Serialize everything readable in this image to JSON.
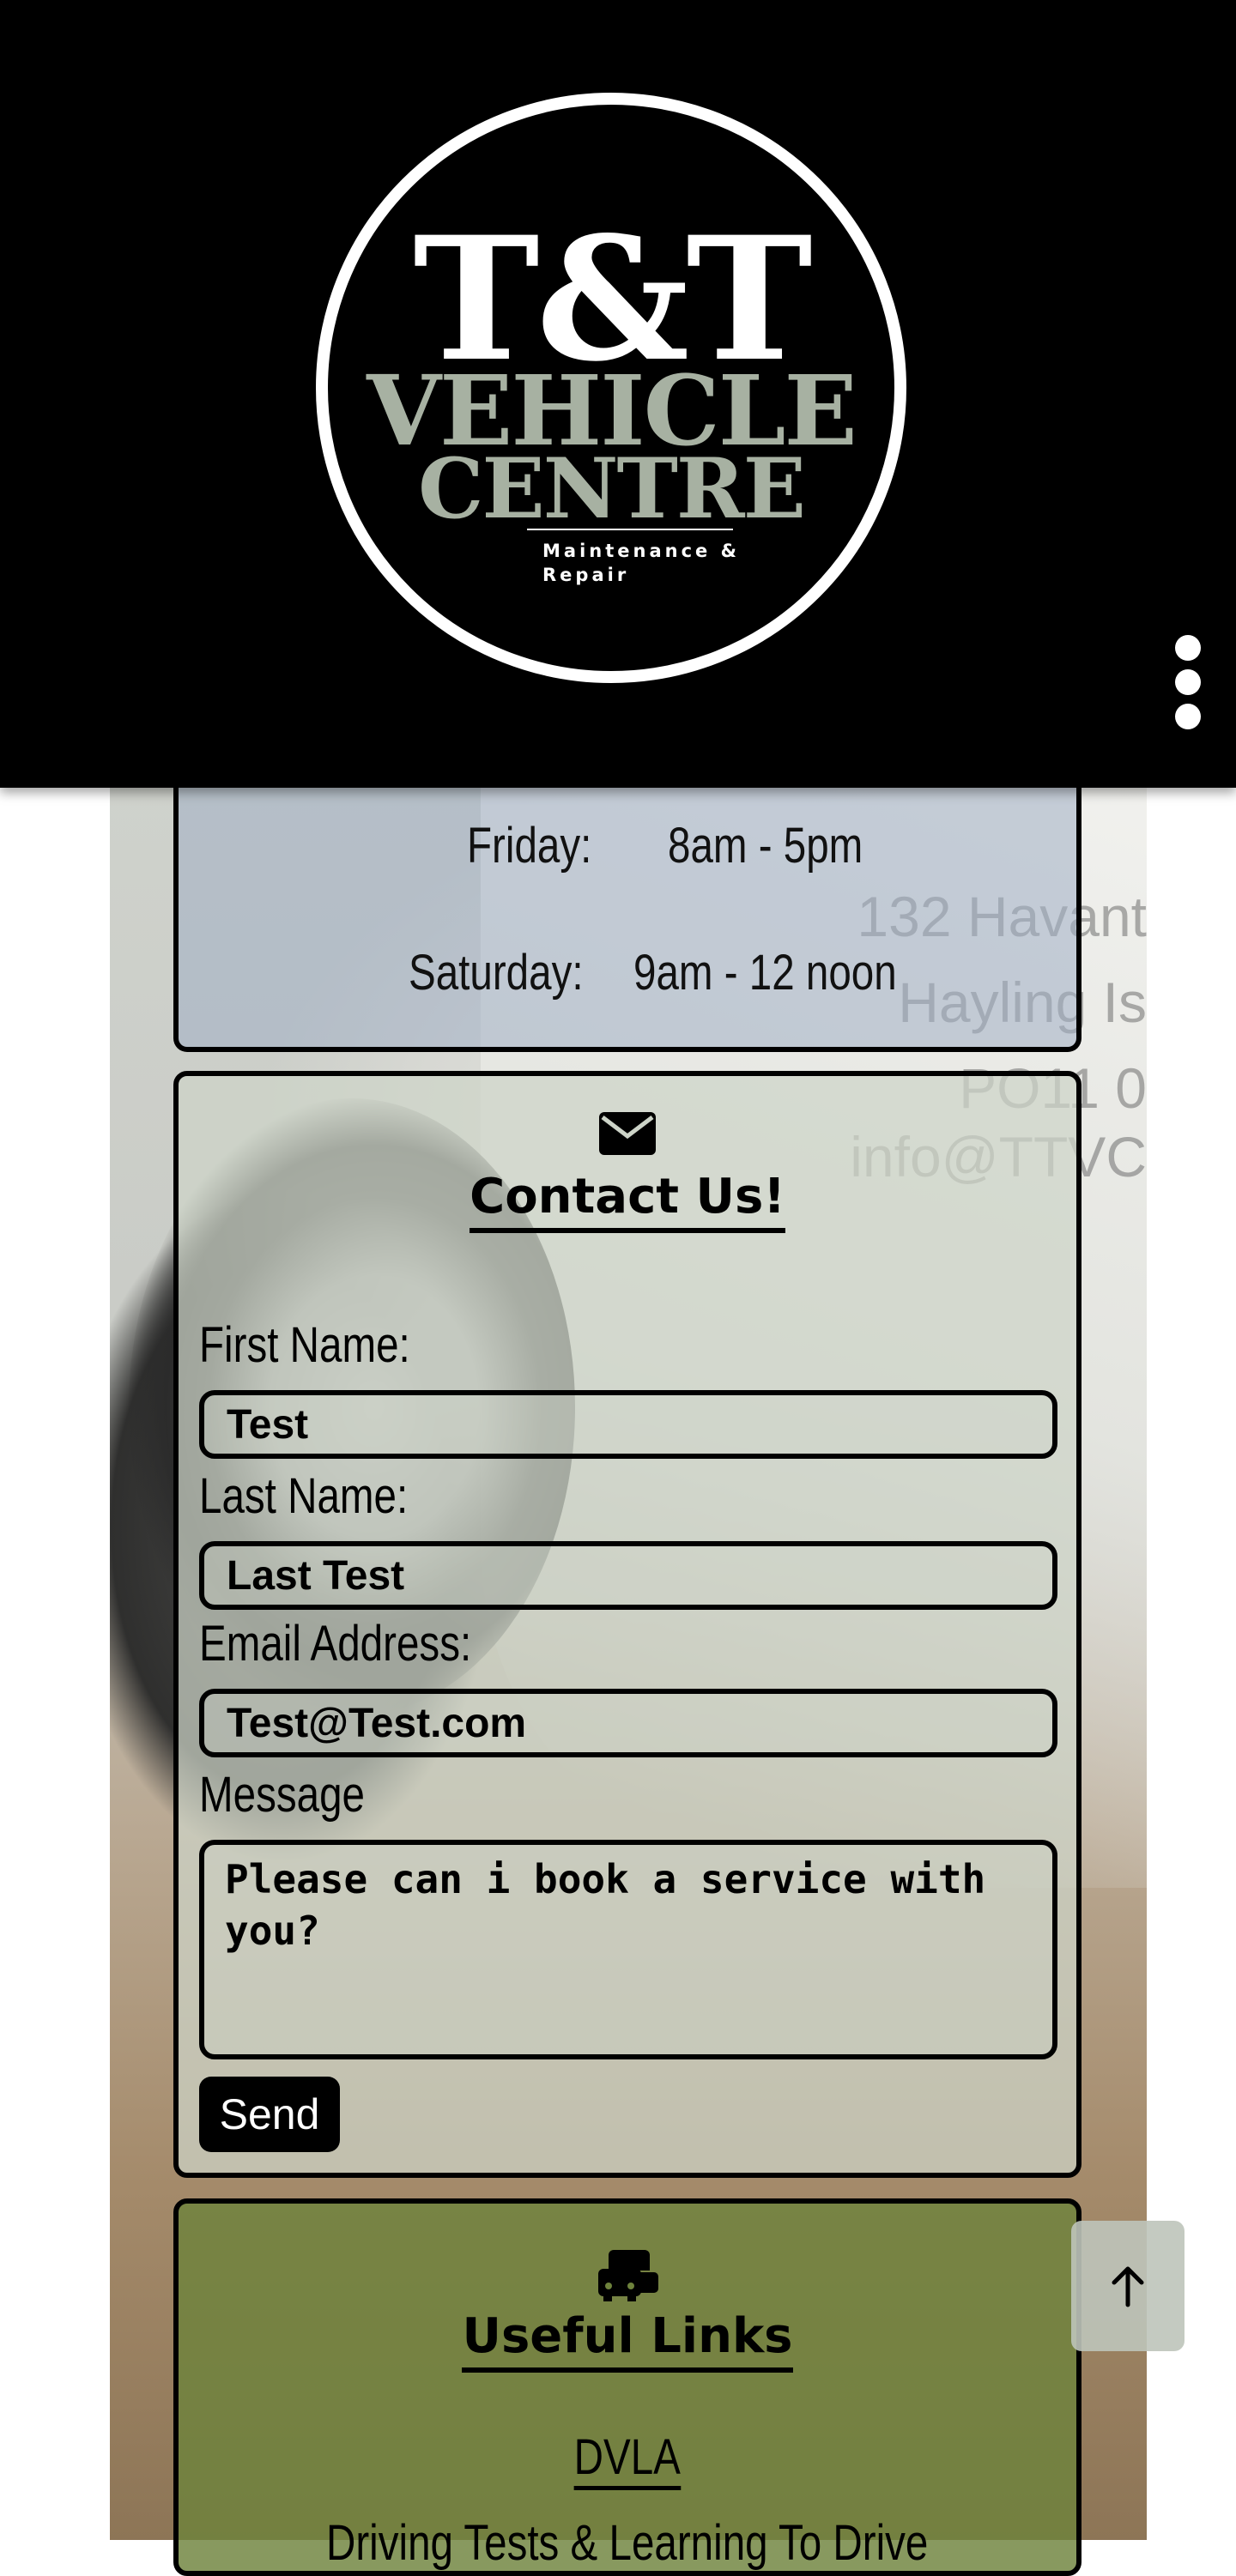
{
  "header": {
    "logo": {
      "line1": "T&T",
      "line2": "VEHICLE",
      "line3": "CENTRE",
      "tagline": "Maintenance & Repair"
    },
    "menu_icon": "more-vertical-icon"
  },
  "background_text": [
    "132 Havant",
    "Hayling Is",
    "PO11 0",
    "info@TTVC"
  ],
  "hours": {
    "rows": [
      {
        "day": "Friday:",
        "time": "8am - 5pm"
      },
      {
        "day": "Saturday:",
        "time": "9am - 12 noon"
      }
    ]
  },
  "contact": {
    "icon": "envelope-icon",
    "title": "Contact Us!",
    "first_name": {
      "label": "First Name:",
      "value": "Test"
    },
    "last_name": {
      "label": "Last Name:",
      "value": "Last Test"
    },
    "email": {
      "label": "Email Address:",
      "value": "Test@Test.com"
    },
    "message": {
      "label": "Message",
      "value": "Please can i book a service with you?"
    },
    "send_label": "Send"
  },
  "links": {
    "icon": "cars-icon",
    "title": "Useful Links",
    "items": [
      "DVLA",
      "Driving Tests & Learning To Drive"
    ]
  },
  "scroll_top_icon": "arrow-up-icon",
  "colors": {
    "header_bg": "#000000",
    "logo_accent": "#a7b1a2",
    "hours_panel": "#a0aec4",
    "contact_panel": "#cdd4c8",
    "links_panel": "#6e823c"
  }
}
